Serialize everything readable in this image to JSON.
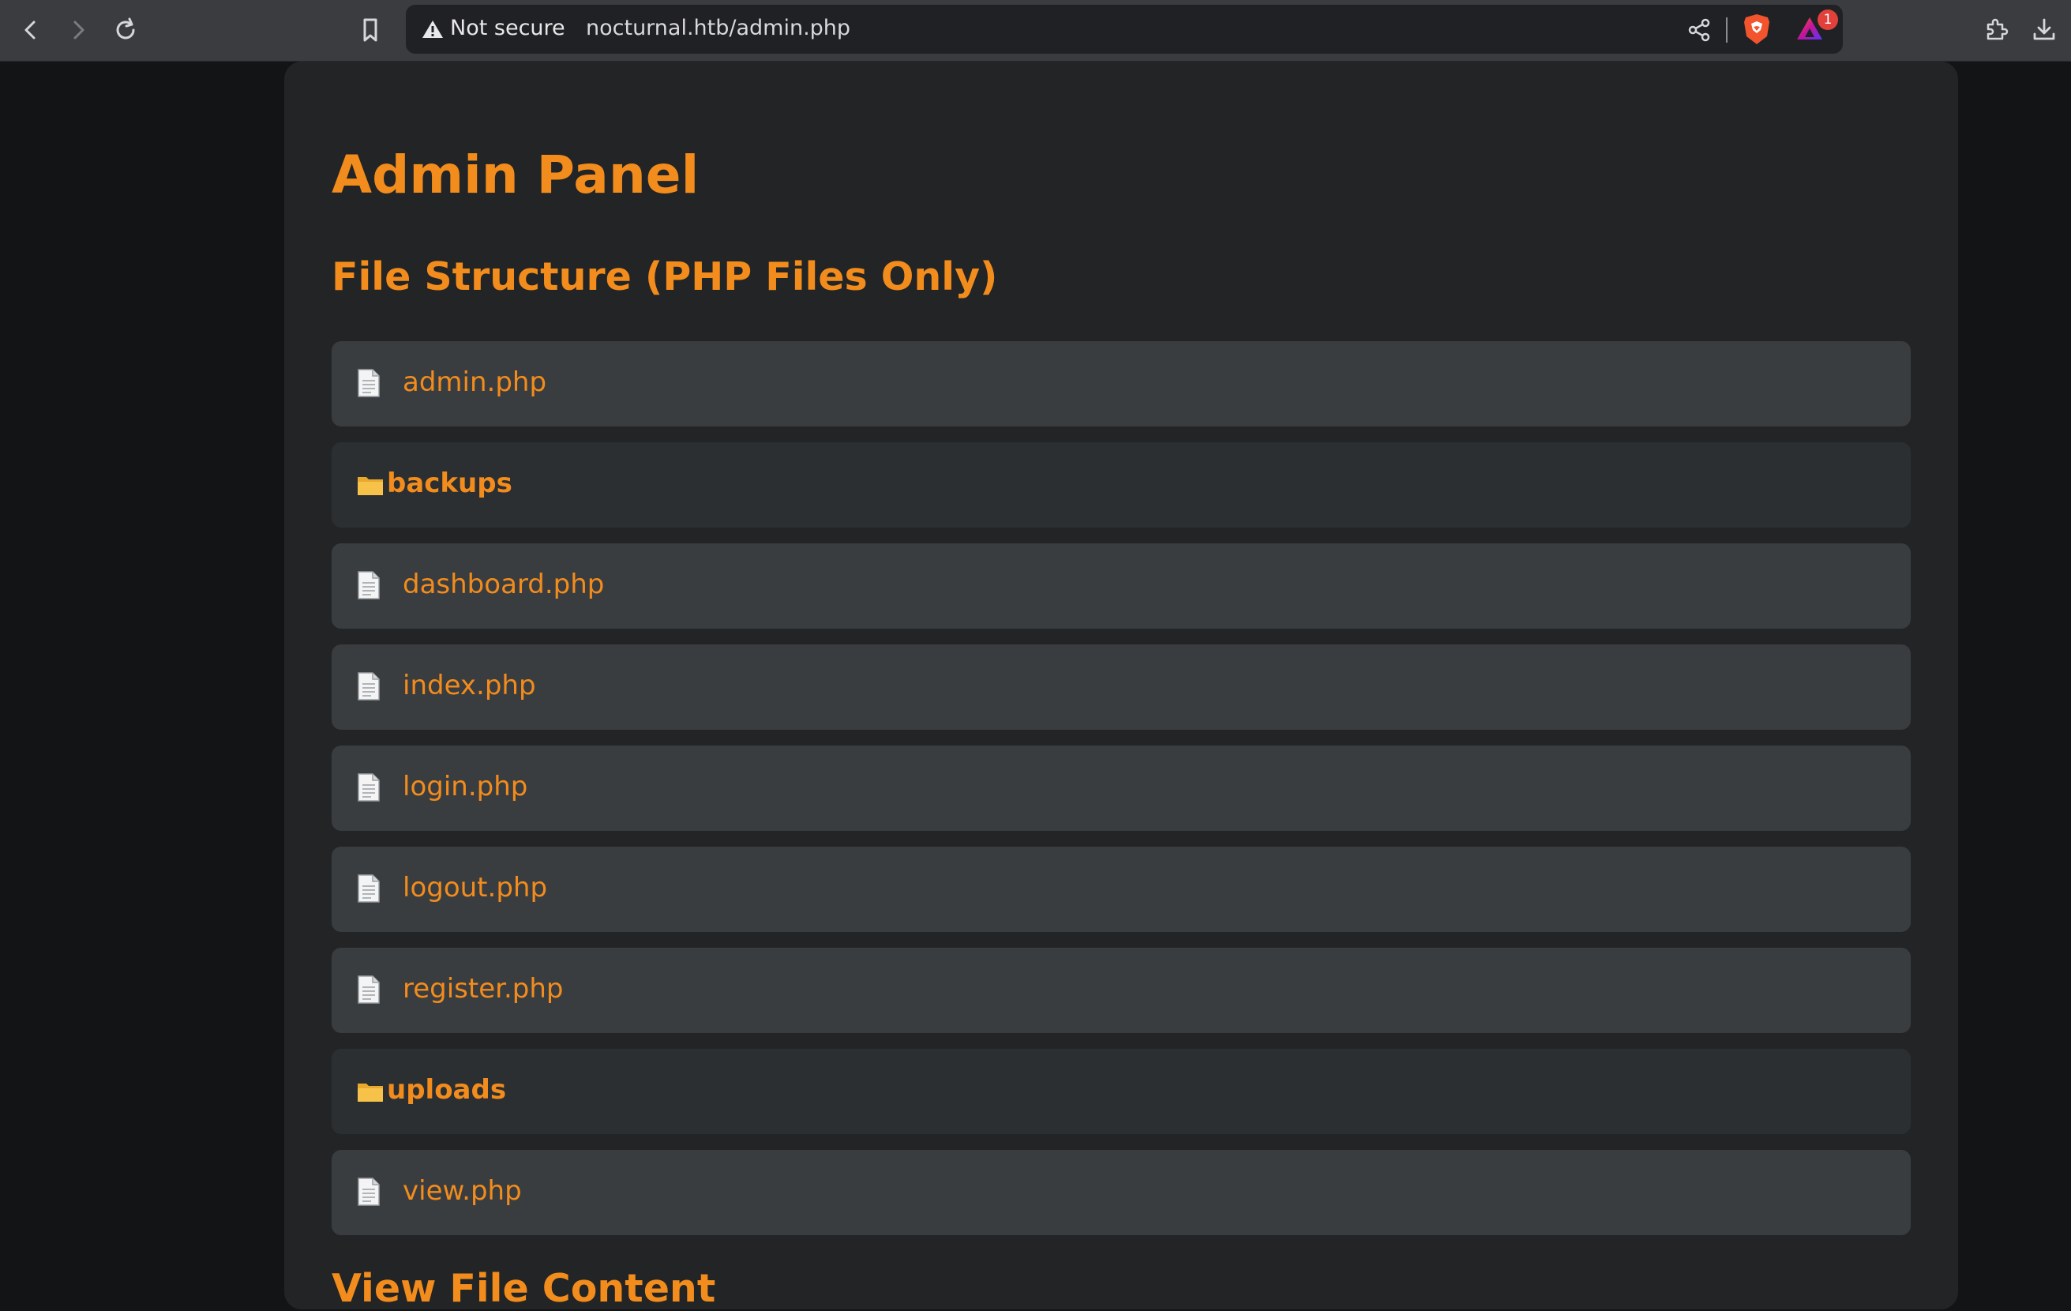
{
  "browser": {
    "security_label": "Not secure",
    "url": "nocturnal.htb/admin.php",
    "badge_count": "1",
    "icons": [
      "back-icon",
      "forward-icon",
      "reload-icon",
      "bookmark-icon",
      "warning-icon",
      "share-icon",
      "brave-shield-icon",
      "brave-rewards-icon",
      "extensions-icon",
      "download-icon"
    ]
  },
  "page": {
    "title": "Admin Panel",
    "file_structure_heading": "File Structure (PHP Files Only)",
    "view_heading": "View File Content",
    "entries": [
      {
        "type": "file",
        "name": "admin.php"
      },
      {
        "type": "folder",
        "name": "backups"
      },
      {
        "type": "file",
        "name": "dashboard.php"
      },
      {
        "type": "file",
        "name": "index.php"
      },
      {
        "type": "file",
        "name": "login.php"
      },
      {
        "type": "file",
        "name": "logout.php"
      },
      {
        "type": "file",
        "name": "register.php"
      },
      {
        "type": "folder",
        "name": "uploads"
      },
      {
        "type": "file",
        "name": "view.php"
      }
    ]
  },
  "colors": {
    "accent": "#f28c1c",
    "panel_bg": "#222426",
    "row_bg": "#3a3d40",
    "folder_row_bg": "#2c2f32",
    "page_bg": "#131415"
  }
}
